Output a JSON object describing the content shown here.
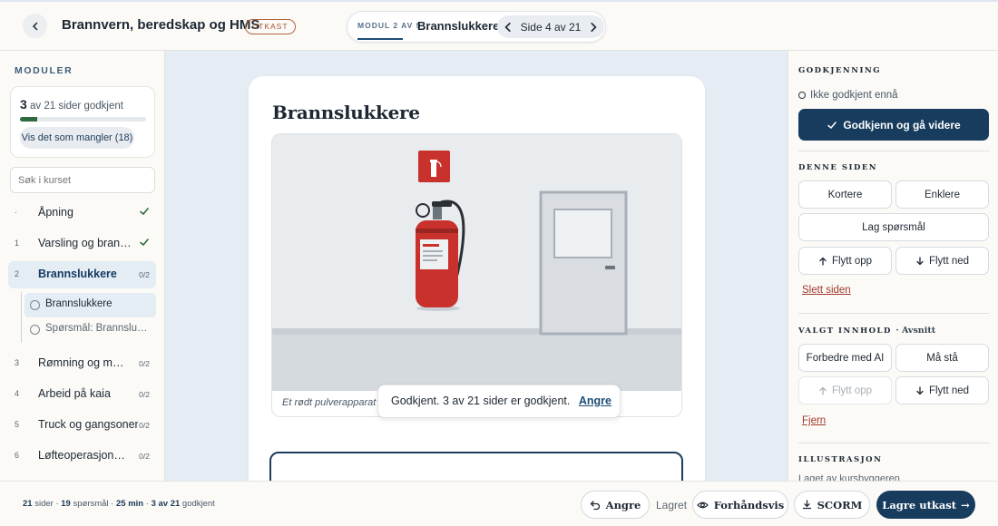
{
  "header": {
    "title": "Brannvern, beredskap og HMS",
    "draft_badge": "UTKAST",
    "module_label": "MODUL 2 AV 9",
    "module_name": "Brannslukkere",
    "page_indicator": "Side 4 av 21"
  },
  "sidebar": {
    "heading": "MODULER",
    "progress": {
      "approved": "3",
      "suffix": "av 21 sider godkjent",
      "fraction": 0.14,
      "missing_button": "Vis det som mangler (18)"
    },
    "search_placeholder": "Søk i kurset",
    "modules": [
      {
        "num": "·",
        "label": "Åpning",
        "status": "check"
      },
      {
        "num": "1",
        "label": "Varsling og brannalarm",
        "status": "check"
      },
      {
        "num": "2",
        "label": "Brannslukkere",
        "meta": "0/2"
      },
      {
        "num": "3",
        "label": "Rømning og møteplass",
        "meta": "0/2"
      },
      {
        "num": "4",
        "label": "Arbeid på kaia",
        "meta": "0/2"
      },
      {
        "num": "5",
        "label": "Truck og gangsoner",
        "meta": "0/2"
      },
      {
        "num": "6",
        "label": "Løfteoperasjoner og kran",
        "meta": "0/2"
      }
    ],
    "subpages": [
      {
        "label": "Brannslukkere"
      },
      {
        "label": "Spørsmål: Brannslukkere"
      }
    ]
  },
  "main": {
    "page_heading": "Brannslukkere",
    "caption": "Et rødt pulverapparat på veggen",
    "toast": {
      "message": "Godkjent. 3 av 21 sider er godkjent.",
      "undo": "Angre"
    }
  },
  "right_panel": {
    "approval_heading": "GODKJENNING",
    "status": "Ikke godkjent ennå",
    "approve_button": "Godkjenn og gå videre",
    "page_heading": "DENNE SIDEN",
    "shorten": "Kortere",
    "simplify": "Enklere",
    "make_questions": "Lag spørsmål",
    "move_up": "Flytt opp",
    "move_down": "Flytt ned",
    "delete_page": "Slett siden",
    "selected_heading": "VALGT INNHOLD",
    "selected_sub": "· Avsnitt",
    "improve_ai": "Forbedre med AI",
    "keep": "Må stå",
    "sel_move_up": "Flytt opp",
    "sel_move_down": "Flytt ned",
    "remove": "Fjern",
    "illustration_heading": "ILLUSTRASJON",
    "illustration_note": "Laget av kursbyggeren"
  },
  "footer": {
    "pages_count": "21",
    "pages_label": "sider",
    "questions_count": "19",
    "questions_label": "spørsmål",
    "duration": "25 min",
    "approved": "3 av 21",
    "approved_label": "godkjent",
    "undo": "Angre",
    "saved": "Lagret",
    "preview": "Forhåndsvis",
    "scorm": "SCORM",
    "save_draft": "Lagre utkast",
    "save_arrow": "→"
  },
  "colors": {
    "primary": "#173c5e",
    "accent_red": "#a13a2a",
    "check_green": "#2e6b3f",
    "canvas_bg": "#e5ecf4"
  },
  "icons": [
    "chevron-left-icon",
    "chevron-right-icon",
    "check-icon",
    "arrow-up-icon",
    "arrow-down-icon",
    "undo-icon",
    "eye-icon",
    "download-icon"
  ]
}
